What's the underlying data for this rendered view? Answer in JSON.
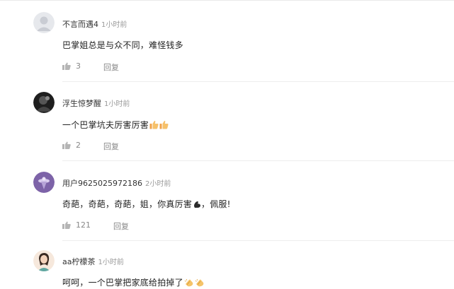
{
  "comments": [
    {
      "username": "不言而遇4",
      "time": "1小时前",
      "content": "巴掌姐总是与众不同，难怪钱多",
      "emojis": [],
      "likes": "3",
      "reply_label": "回复",
      "avatar_color": "#d9dbe0"
    },
    {
      "username": "浮生惊梦醒",
      "time": "1小时前",
      "content": "一个巴掌坑夫厉害厉害",
      "emojis": [
        "thumbs-up-icon",
        "thumbs-up-icon"
      ],
      "likes": "2",
      "reply_label": "回复",
      "avatar_color": "#2a2a2a"
    },
    {
      "username": "用户9625025972186",
      "time": "2小时前",
      "content": "奇葩，奇葩，奇葩，姐，你真厉害",
      "content_tail": "，佩服!",
      "emojis": [
        "muscle-icon"
      ],
      "likes": "121",
      "reply_label": "回复",
      "avatar_color": "#8e74b8"
    },
    {
      "username": "aa柠檬茶",
      "time": "1小时前",
      "content": "呵呵，一个巴掌把家底给拍掉了",
      "emojis": [
        "clap-icon",
        "clap-icon"
      ],
      "likes": "",
      "reply_label": "",
      "avatar_color": "#f3d9c6"
    }
  ]
}
